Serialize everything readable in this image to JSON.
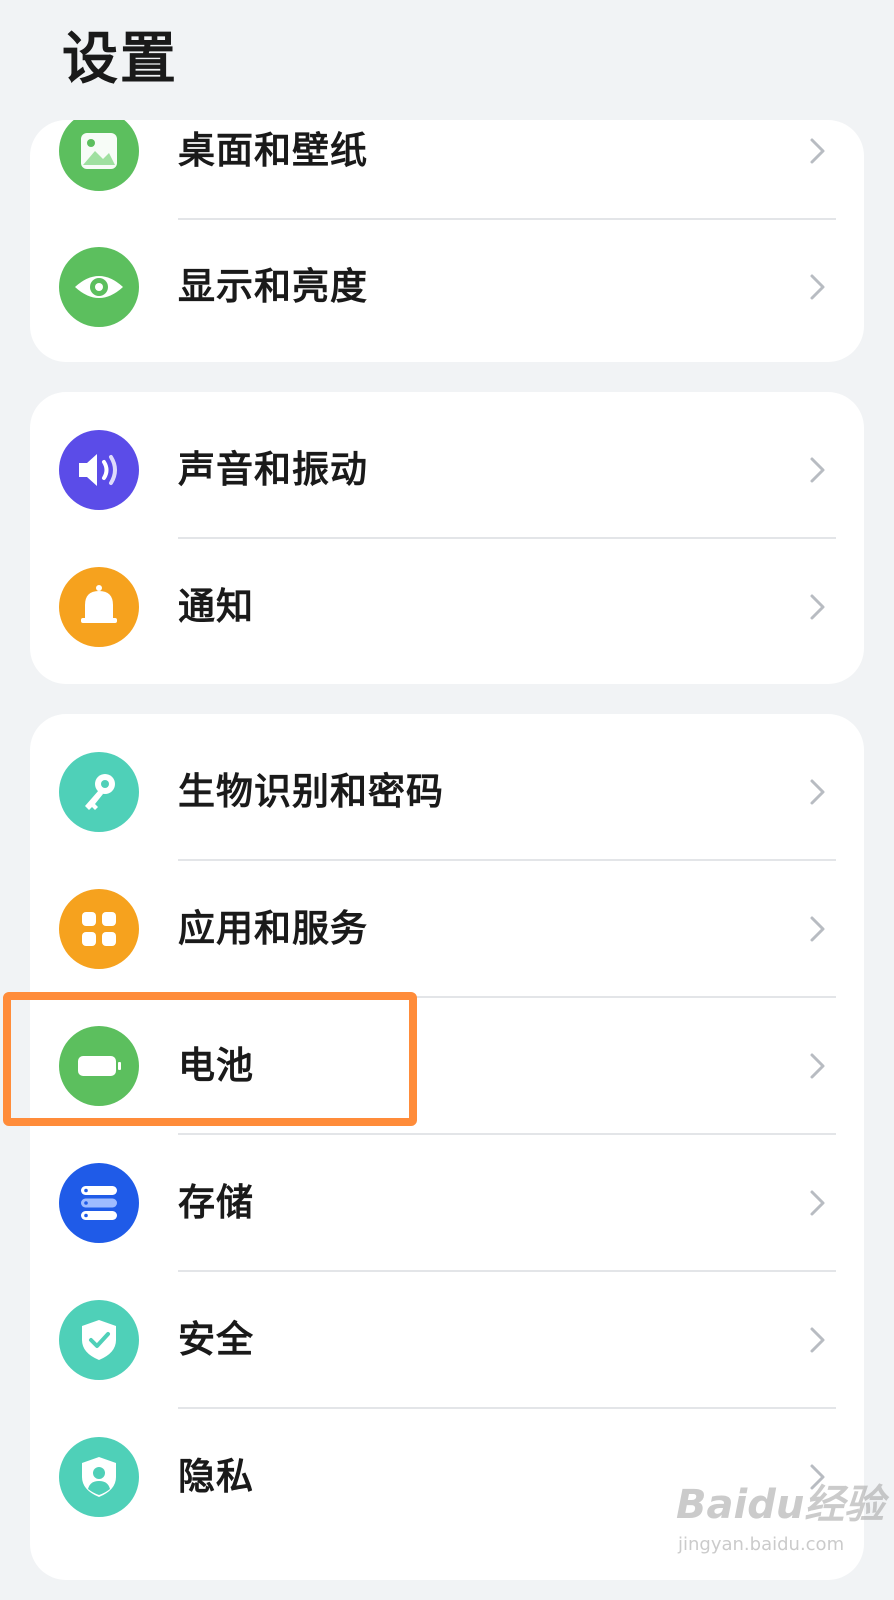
{
  "header": {
    "title": "设置"
  },
  "groups": [
    {
      "items": [
        {
          "label": "桌面和壁纸",
          "icon": "wallpaper-icon",
          "color": "#5cbf5e"
        },
        {
          "label": "显示和亮度",
          "icon": "eye-icon",
          "color": "#5cbf5e"
        }
      ]
    },
    {
      "items": [
        {
          "label": "声音和振动",
          "icon": "speaker-icon",
          "color": "#5b4ce8"
        },
        {
          "label": "通知",
          "icon": "bell-icon",
          "color": "#f6a21e"
        }
      ]
    },
    {
      "items": [
        {
          "label": "生物识别和密码",
          "icon": "key-icon",
          "color": "#4fd0b8"
        },
        {
          "label": "应用和服务",
          "icon": "apps-grid-icon",
          "color": "#f6a21e"
        },
        {
          "label": "电池",
          "icon": "battery-icon",
          "color": "#5cbf5e",
          "highlighted": true
        },
        {
          "label": "存储",
          "icon": "storage-icon",
          "color": "#1f5be8"
        },
        {
          "label": "安全",
          "icon": "shield-check-icon",
          "color": "#4fd0b8"
        },
        {
          "label": "隐私",
          "icon": "privacy-shield-icon",
          "color": "#4fd0b8"
        }
      ]
    }
  ],
  "annotation": {
    "highlight_color": "#ff8c3a"
  },
  "watermark": {
    "logo": "Baidu经验",
    "sub": "jingyan.baidu.com"
  }
}
